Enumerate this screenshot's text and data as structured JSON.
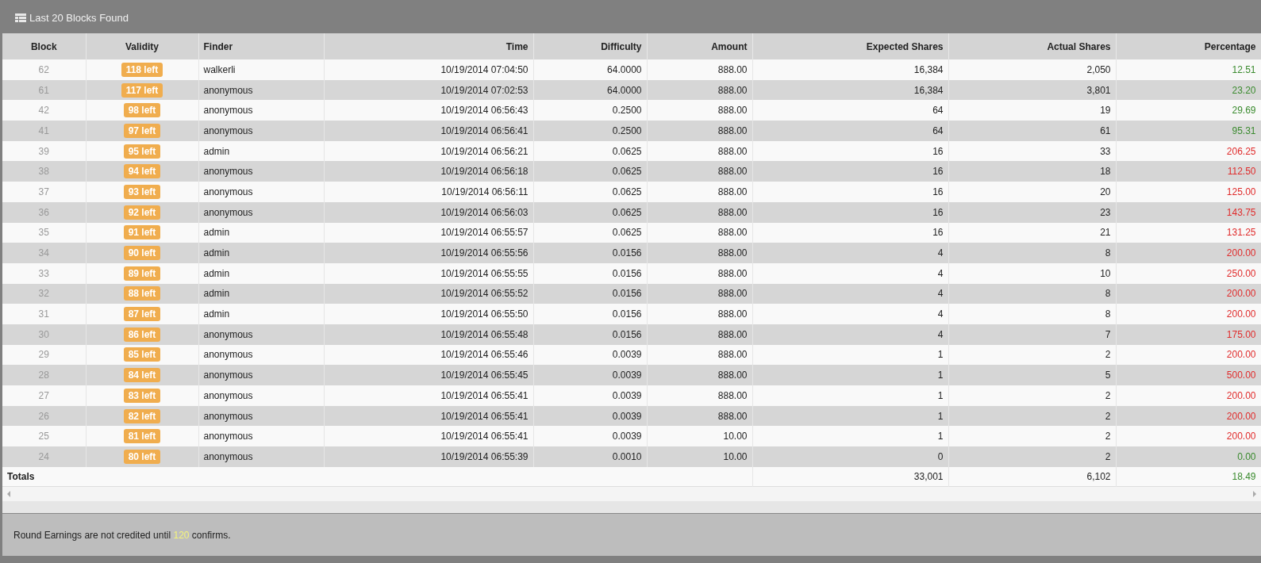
{
  "panel": {
    "title": "Last 20 Blocks Found"
  },
  "table": {
    "columns": [
      "Block",
      "Validity",
      "Finder",
      "Time",
      "Difficulty",
      "Amount",
      "Expected Shares",
      "Actual Shares",
      "Percentage"
    ],
    "rows": [
      {
        "block": "62",
        "validity": "118 left",
        "finder": "walkerli",
        "time": "10/19/2014 07:04:50",
        "difficulty": "64.0000",
        "amount": "888.00",
        "expected": "16,384",
        "actual": "2,050",
        "percentage": "12.51",
        "color": "#3a8a2e"
      },
      {
        "block": "61",
        "validity": "117 left",
        "finder": "anonymous",
        "time": "10/19/2014 07:02:53",
        "difficulty": "64.0000",
        "amount": "888.00",
        "expected": "16,384",
        "actual": "3,801",
        "percentage": "23.20",
        "color": "#3a8a2e"
      },
      {
        "block": "42",
        "validity": "98 left",
        "finder": "anonymous",
        "time": "10/19/2014 06:56:43",
        "difficulty": "0.2500",
        "amount": "888.00",
        "expected": "64",
        "actual": "19",
        "percentage": "29.69",
        "color": "#3a8a2e"
      },
      {
        "block": "41",
        "validity": "97 left",
        "finder": "anonymous",
        "time": "10/19/2014 06:56:41",
        "difficulty": "0.2500",
        "amount": "888.00",
        "expected": "64",
        "actual": "61",
        "percentage": "95.31",
        "color": "#3a8a2e"
      },
      {
        "block": "39",
        "validity": "95 left",
        "finder": "admin",
        "time": "10/19/2014 06:56:21",
        "difficulty": "0.0625",
        "amount": "888.00",
        "expected": "16",
        "actual": "33",
        "percentage": "206.25",
        "color": "#e02b2b"
      },
      {
        "block": "38",
        "validity": "94 left",
        "finder": "anonymous",
        "time": "10/19/2014 06:56:18",
        "difficulty": "0.0625",
        "amount": "888.00",
        "expected": "16",
        "actual": "18",
        "percentage": "112.50",
        "color": "#e02b2b"
      },
      {
        "block": "37",
        "validity": "93 left",
        "finder": "anonymous",
        "time": "10/19/2014 06:56:11",
        "difficulty": "0.0625",
        "amount": "888.00",
        "expected": "16",
        "actual": "20",
        "percentage": "125.00",
        "color": "#e02b2b"
      },
      {
        "block": "36",
        "validity": "92 left",
        "finder": "anonymous",
        "time": "10/19/2014 06:56:03",
        "difficulty": "0.0625",
        "amount": "888.00",
        "expected": "16",
        "actual": "23",
        "percentage": "143.75",
        "color": "#e02b2b"
      },
      {
        "block": "35",
        "validity": "91 left",
        "finder": "admin",
        "time": "10/19/2014 06:55:57",
        "difficulty": "0.0625",
        "amount": "888.00",
        "expected": "16",
        "actual": "21",
        "percentage": "131.25",
        "color": "#e02b2b"
      },
      {
        "block": "34",
        "validity": "90 left",
        "finder": "admin",
        "time": "10/19/2014 06:55:56",
        "difficulty": "0.0156",
        "amount": "888.00",
        "expected": "4",
        "actual": "8",
        "percentage": "200.00",
        "color": "#e02b2b"
      },
      {
        "block": "33",
        "validity": "89 left",
        "finder": "admin",
        "time": "10/19/2014 06:55:55",
        "difficulty": "0.0156",
        "amount": "888.00",
        "expected": "4",
        "actual": "10",
        "percentage": "250.00",
        "color": "#e02b2b"
      },
      {
        "block": "32",
        "validity": "88 left",
        "finder": "admin",
        "time": "10/19/2014 06:55:52",
        "difficulty": "0.0156",
        "amount": "888.00",
        "expected": "4",
        "actual": "8",
        "percentage": "200.00",
        "color": "#e02b2b"
      },
      {
        "block": "31",
        "validity": "87 left",
        "finder": "admin",
        "time": "10/19/2014 06:55:50",
        "difficulty": "0.0156",
        "amount": "888.00",
        "expected": "4",
        "actual": "8",
        "percentage": "200.00",
        "color": "#e02b2b"
      },
      {
        "block": "30",
        "validity": "86 left",
        "finder": "anonymous",
        "time": "10/19/2014 06:55:48",
        "difficulty": "0.0156",
        "amount": "888.00",
        "expected": "4",
        "actual": "7",
        "percentage": "175.00",
        "color": "#e02b2b"
      },
      {
        "block": "29",
        "validity": "85 left",
        "finder": "anonymous",
        "time": "10/19/2014 06:55:46",
        "difficulty": "0.0039",
        "amount": "888.00",
        "expected": "1",
        "actual": "2",
        "percentage": "200.00",
        "color": "#e02b2b"
      },
      {
        "block": "28",
        "validity": "84 left",
        "finder": "anonymous",
        "time": "10/19/2014 06:55:45",
        "difficulty": "0.0039",
        "amount": "888.00",
        "expected": "1",
        "actual": "5",
        "percentage": "500.00",
        "color": "#e02b2b"
      },
      {
        "block": "27",
        "validity": "83 left",
        "finder": "anonymous",
        "time": "10/19/2014 06:55:41",
        "difficulty": "0.0039",
        "amount": "888.00",
        "expected": "1",
        "actual": "2",
        "percentage": "200.00",
        "color": "#e02b2b"
      },
      {
        "block": "26",
        "validity": "82 left",
        "finder": "anonymous",
        "time": "10/19/2014 06:55:41",
        "difficulty": "0.0039",
        "amount": "888.00",
        "expected": "1",
        "actual": "2",
        "percentage": "200.00",
        "color": "#e02b2b"
      },
      {
        "block": "25",
        "validity": "81 left",
        "finder": "anonymous",
        "time": "10/19/2014 06:55:41",
        "difficulty": "0.0039",
        "amount": "10.00",
        "expected": "1",
        "actual": "2",
        "percentage": "200.00",
        "color": "#e02b2b"
      },
      {
        "block": "24",
        "validity": "80 left",
        "finder": "anonymous",
        "time": "10/19/2014 06:55:39",
        "difficulty": "0.0010",
        "amount": "10.00",
        "expected": "0",
        "actual": "2",
        "percentage": "0.00",
        "color": "#3a8a2e"
      }
    ],
    "totals": {
      "label": "Totals",
      "expected": "33,001",
      "actual": "6,102",
      "percentage": "18.49",
      "color": "#3a8a2e"
    }
  },
  "footer": {
    "before": "Round Earnings are not credited until",
    "confirms": "120",
    "after": "confirms."
  }
}
